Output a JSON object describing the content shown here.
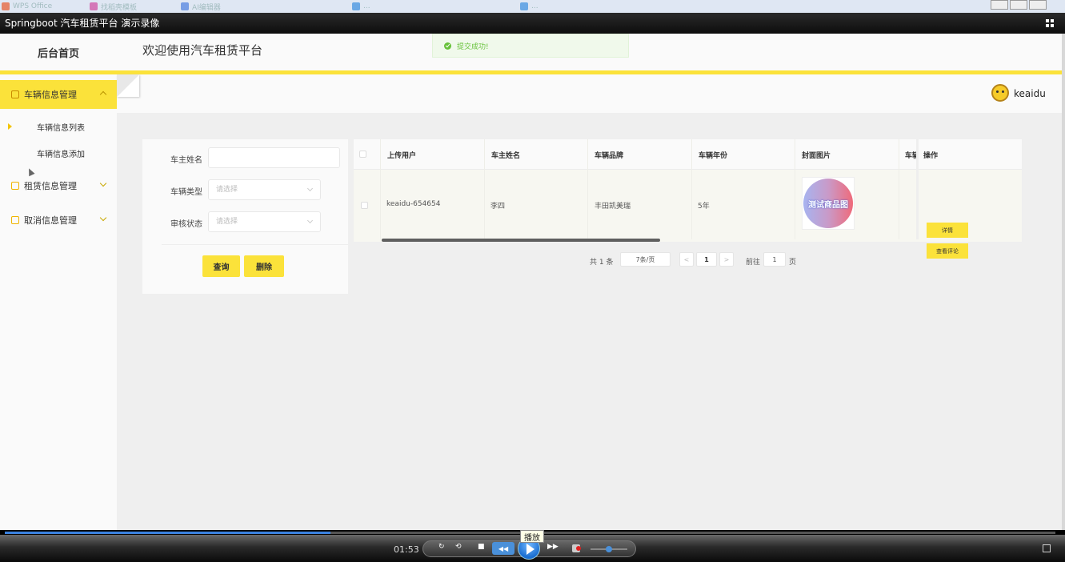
{
  "player": {
    "title": "Springboot 汽车租赁平台 演示录像",
    "time": "01:53",
    "tooltip": "播放",
    "progress_fraction": 0.31
  },
  "sidebar": {
    "brand": "后台首页",
    "groups": [
      {
        "label": "车辆信息管理",
        "expanded": true,
        "items": [
          {
            "label": "车辆信息列表"
          },
          {
            "label": "车辆信息添加"
          }
        ]
      },
      {
        "label": "租赁信息管理",
        "expanded": false
      },
      {
        "label": "取消信息管理",
        "expanded": false
      }
    ]
  },
  "header": {
    "title": "欢迎使用汽车租赁平台",
    "username": "keaidu"
  },
  "toast": {
    "text": "提交成功!"
  },
  "search": {
    "owner_label": "车主姓名",
    "owner_value": "",
    "type_label": "车辆类型",
    "type_placeholder": "请选择",
    "status_label": "审核状态",
    "status_placeholder": "请选择",
    "query_button": "查询",
    "delete_button": "删除"
  },
  "table": {
    "columns": [
      "上传用户",
      "车主姓名",
      "车辆品牌",
      "车辆年份",
      "封面图片",
      "车辆",
      "操作"
    ],
    "rows": [
      {
        "uploader": "keaidu-654654",
        "owner": "李四",
        "brand": "丰田凯美瑞",
        "year": "5年",
        "cover_text": "测试商品图",
        "detail_button": "详情",
        "comment_button": "查看评论"
      }
    ]
  },
  "pagination": {
    "total": "共 1 条",
    "page_size": "7条/页",
    "current_page": "1",
    "goto_label": "前往",
    "goto_value": "1",
    "page_suffix": "页"
  },
  "colors": {
    "accent": "#fbe23a",
    "success": "#67c23a"
  }
}
